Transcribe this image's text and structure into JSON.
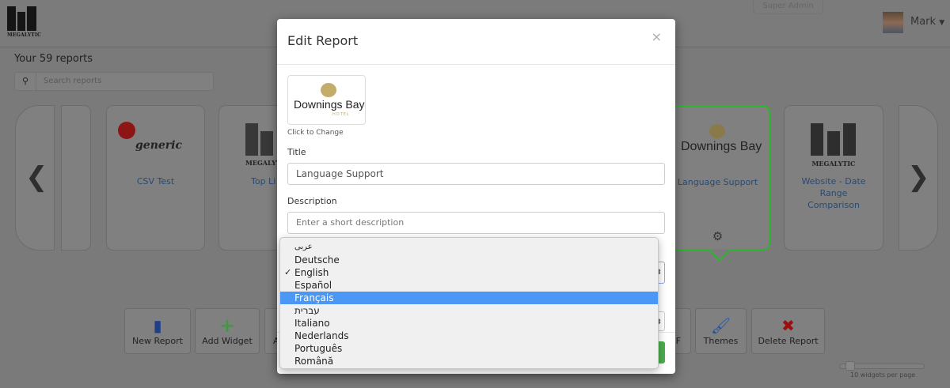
{
  "header": {
    "brand": "MEGALYTIC",
    "role_badge": "Super Admin",
    "user_name": "Mark"
  },
  "reports": {
    "count_label": "Your 59 reports",
    "search_placeholder": "Search reports",
    "cards": [
      {
        "title": "CSV Test",
        "logo": "generic"
      },
      {
        "title": "Top Li",
        "logo": "megalytic"
      },
      {
        "title": "Language Support",
        "logo": "downings-bay",
        "selected": true
      },
      {
        "title": "Website - Date Range Comparison",
        "logo": "megalytic"
      }
    ]
  },
  "toolbar": {
    "new_report": "New Report",
    "add_widget": "Add Widget",
    "partial_left": "A",
    "partial_pdf": "F",
    "themes": "Themes",
    "delete_report": "Delete Report"
  },
  "pagination": {
    "widgets_per_page_label": "10 widgets per page",
    "widgets_per_page": 10
  },
  "modal": {
    "title": "Edit Report",
    "close": "×",
    "logo_text": "Downings Bay",
    "logo_subtext": "HOTEL",
    "click_to_change": "Click to Change",
    "title_label": "Title",
    "title_value": "Language Support",
    "description_label": "Description",
    "description_placeholder": "Enter a short description"
  },
  "language_dropdown": {
    "options": [
      "عربى",
      "Deutsche",
      "English",
      "Español",
      "Français",
      "עברית",
      "Italiano",
      "Nederlands",
      "Português",
      "Română"
    ],
    "checked": "English",
    "highlighted": "Français",
    "check_mark": "✓"
  },
  "colors": {
    "accent_green": "#2db52d",
    "highlight": "#4a97f5",
    "link": "#284a74"
  }
}
